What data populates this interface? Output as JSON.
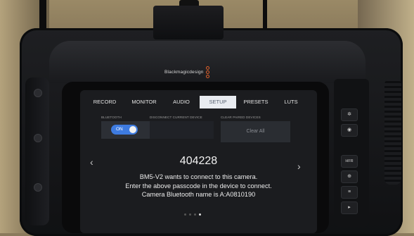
{
  "camera": {
    "brand": "Blackmagicdesign",
    "brand_color": "#e0602a"
  },
  "tabs": [
    {
      "label": "RECORD",
      "active": false
    },
    {
      "label": "MONITOR",
      "active": false
    },
    {
      "label": "AUDIO",
      "active": false
    },
    {
      "label": "SETUP",
      "active": true
    },
    {
      "label": "PRESETS",
      "active": false
    },
    {
      "label": "LUTS",
      "active": false
    }
  ],
  "setup": {
    "bluetooth_label": "BLUETOOTH",
    "bluetooth_toggle": "ON",
    "disconnect_label": "DISCONNECT CURRENT DEVICE",
    "clear_label": "CLEAR PAIRED DEVICES",
    "clear_button": "Clear All"
  },
  "dialog": {
    "passcode": "404228",
    "line1": "BM5-V2 wants to connect to this camera.",
    "line2": "Enter the above passcode in the device to connect.",
    "line3": "Camera Bluetooth name is A:A0810190"
  },
  "nav": {
    "prev": "‹",
    "next": "›",
    "pages": 4,
    "current_page": 4
  },
  "side_buttons": {
    "hfr": "HFR"
  },
  "colors": {
    "accent": "#3e7be0",
    "active_tab": "#e9ecf1"
  }
}
